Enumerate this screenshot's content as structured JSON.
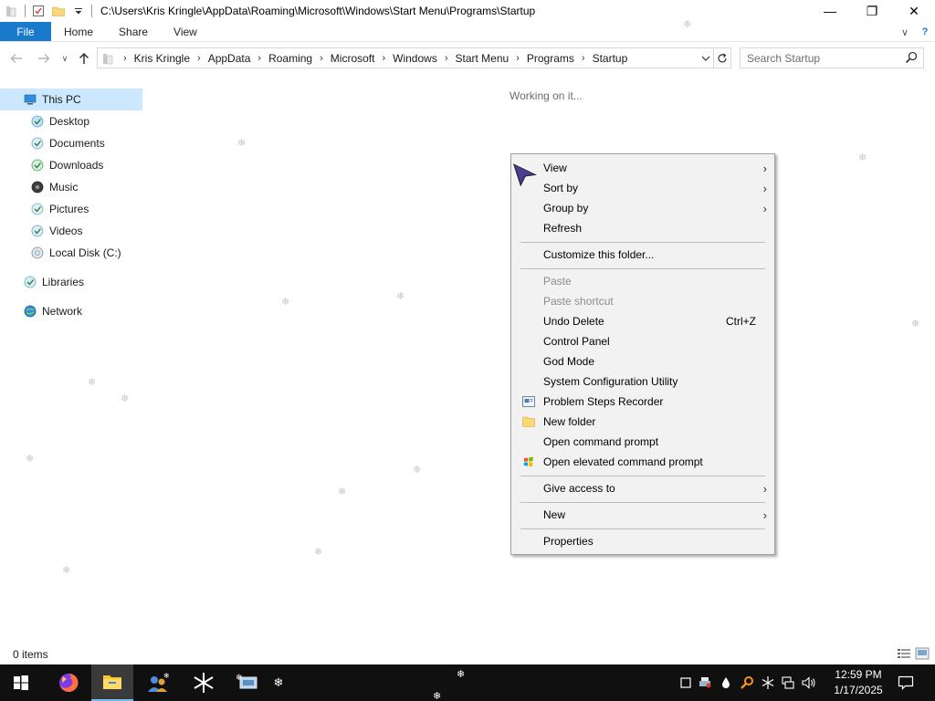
{
  "window": {
    "title_path": "C:\\Users\\Kris Kringle\\AppData\\Roaming\\Microsoft\\Windows\\Start Menu\\Programs\\Startup",
    "minimize_glyph": "—",
    "maximize_glyph": "❐",
    "close_glyph": "✕"
  },
  "ribbon": {
    "tabs": [
      "File",
      "Home",
      "Share",
      "View"
    ],
    "expand_glyph": "∨",
    "help_glyph": "?"
  },
  "address": {
    "crumbs": [
      "Kris Kringle",
      "AppData",
      "Roaming",
      "Microsoft",
      "Windows",
      "Start Menu",
      "Programs",
      "Startup"
    ],
    "search_placeholder": "Search Startup"
  },
  "nav": {
    "this_pc": "This PC",
    "items": [
      "Desktop",
      "Documents",
      "Downloads",
      "Music",
      "Pictures",
      "Videos",
      "Local Disk (C:)"
    ],
    "libraries": "Libraries",
    "network": "Network"
  },
  "content": {
    "status_message": "Working on it..."
  },
  "context_menu": {
    "view": "View",
    "sort_by": "Sort by",
    "group_by": "Group by",
    "refresh": "Refresh",
    "customize": "Customize this folder...",
    "paste": "Paste",
    "paste_shortcut": "Paste shortcut",
    "undo_delete": "Undo Delete",
    "undo_shortcut": "Ctrl+Z",
    "control_panel": "Control Panel",
    "god_mode": "God Mode",
    "sys_config": "System Configuration Utility",
    "psr": "Problem Steps Recorder",
    "new_folder": "New folder",
    "open_cmd": "Open command prompt",
    "open_elevated": "Open elevated command prompt",
    "give_access": "Give access to",
    "new": "New",
    "properties": "Properties",
    "submenu_glyph": "›"
  },
  "statusbar": {
    "items_count": "0 items"
  },
  "taskbar": {
    "time": "12:59 PM",
    "date": "1/17/2025"
  },
  "colors": {
    "accent": "#1979ca",
    "selection": "#cce8ff",
    "taskbar": "#101010",
    "menu_bg": "#f2f2f2"
  }
}
